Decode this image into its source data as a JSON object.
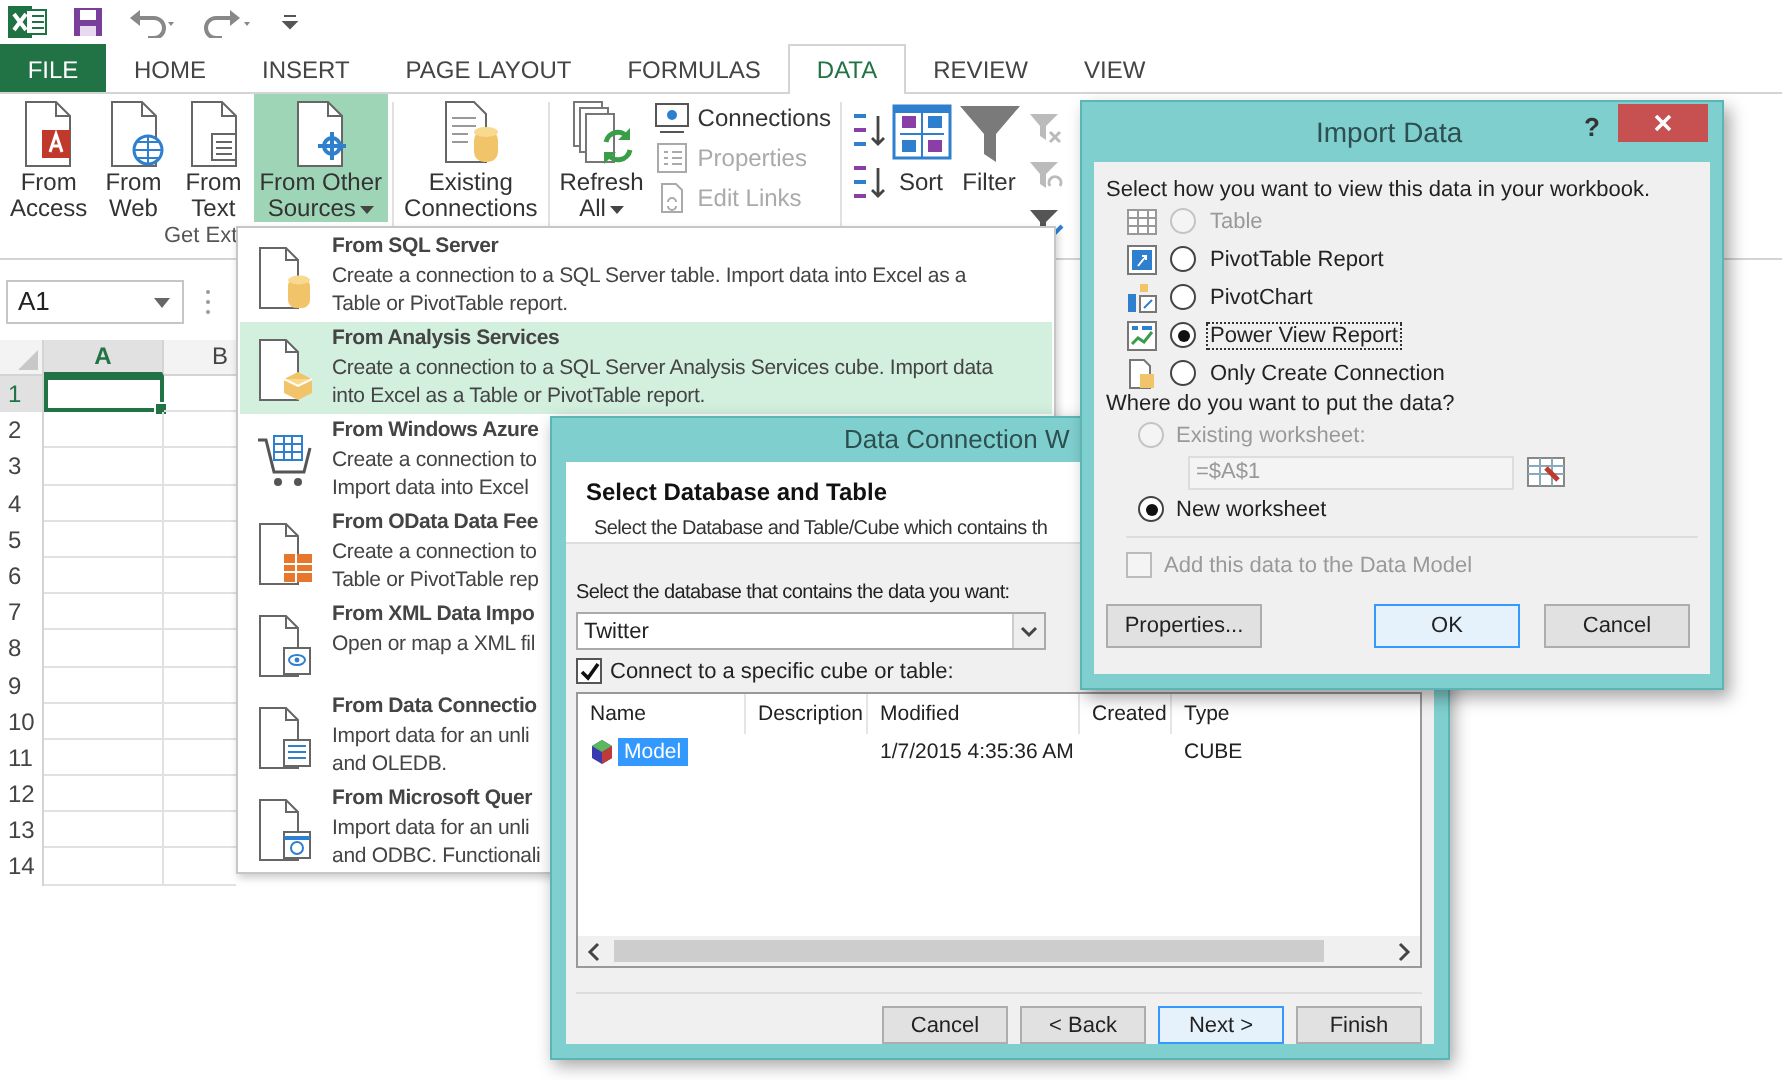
{
  "ribbon": {
    "tabs": [
      {
        "label": "FILE",
        "kind": "file",
        "selected": false
      },
      {
        "label": "HOME",
        "kind": "tab",
        "selected": false
      },
      {
        "label": "INSERT",
        "kind": "tab",
        "selected": false
      },
      {
        "label": "PAGE LAYOUT",
        "kind": "tab",
        "selected": false
      },
      {
        "label": "FORMULAS",
        "kind": "tab",
        "selected": false
      },
      {
        "label": "DATA",
        "kind": "tab",
        "selected": true
      },
      {
        "label": "REVIEW",
        "kind": "tab",
        "selected": false
      },
      {
        "label": "VIEW",
        "kind": "tab",
        "selected": false
      }
    ],
    "external_buttons": [
      {
        "lines": [
          "From",
          "Access"
        ],
        "kind": "access",
        "selected": false,
        "dropdown": false
      },
      {
        "lines": [
          "From",
          "Web"
        ],
        "kind": "web",
        "selected": false,
        "dropdown": false
      },
      {
        "lines": [
          "From",
          "Text"
        ],
        "kind": "text",
        "selected": false,
        "dropdown": false
      },
      {
        "lines": [
          "From Other",
          "Sources"
        ],
        "kind": "other",
        "selected": true,
        "dropdown": true
      }
    ],
    "existing": {
      "lines": [
        "Existing",
        "Connections"
      ]
    },
    "group_label": "Get Ext",
    "refresh": {
      "lines": [
        "Refresh",
        "All"
      ],
      "dropdown": true
    },
    "connection_items": [
      {
        "label": "Connections",
        "kind": "connections",
        "disabled": false
      },
      {
        "label": "Properties",
        "kind": "properties",
        "disabled": true
      },
      {
        "label": "Edit Links",
        "kind": "links",
        "disabled": true
      }
    ],
    "sort": {
      "label": "Sort"
    },
    "filter": {
      "label": "Filter"
    }
  },
  "name_box": {
    "value": "A1"
  },
  "sheet": {
    "columns": [
      {
        "label": "A",
        "selected": true
      },
      {
        "label": "B",
        "selected": false
      }
    ],
    "rows": [
      {
        "label": "1",
        "selected": true
      },
      {
        "label": "2",
        "selected": false
      },
      {
        "label": "3",
        "selected": false
      },
      {
        "label": "4",
        "selected": false
      },
      {
        "label": "5",
        "selected": false
      },
      {
        "label": "6",
        "selected": false
      },
      {
        "label": "7",
        "selected": false
      },
      {
        "label": "8",
        "selected": false
      },
      {
        "label": "9",
        "selected": false
      },
      {
        "label": "10",
        "selected": false
      },
      {
        "label": "11",
        "selected": false
      },
      {
        "label": "12",
        "selected": false
      },
      {
        "label": "13",
        "selected": false
      },
      {
        "label": "14",
        "selected": false
      }
    ]
  },
  "source_menu": [
    {
      "title": "From SQL Server",
      "description": [
        "Create a connection to a SQL Server table. Import data into Excel as a",
        "Table or PivotTable report."
      ],
      "kind": "sql",
      "selected": false
    },
    {
      "title": "From Analysis Services",
      "description": [
        "Create a connection to a SQL Server Analysis Services cube. Import data",
        "into Excel as a Table or PivotTable report."
      ],
      "kind": "cube",
      "selected": true
    },
    {
      "title": "From Windows Azure",
      "description": [
        "Create a connection to",
        "Import data into Excel"
      ],
      "kind": "cart",
      "selected": false
    },
    {
      "title": "From OData Data Fee",
      "description": [
        "Create a connection to",
        "Table or PivotTable rep"
      ],
      "kind": "odata",
      "selected": false
    },
    {
      "title": "From XML Data Impo",
      "description": [
        "Open or map a XML fil"
      ],
      "kind": "xml",
      "selected": false
    },
    {
      "title": "From Data Connectio",
      "description": [
        "Import data for an unli",
        "and OLEDB."
      ],
      "kind": "connection",
      "selected": false
    },
    {
      "title": "From Microsoft Quer",
      "description": [
        "Import data for an unli",
        "and ODBC. Functionali"
      ],
      "kind": "query",
      "selected": false
    }
  ],
  "wizard": {
    "title": "Data Connection W",
    "heading": "Select Database and Table",
    "subtitle": "Select the Database and Table/Cube which contains th",
    "database_label": "Select the database that contains the data you want:",
    "database_value": "Twitter",
    "connect_checkbox": {
      "label": "Connect to a specific cube or table:",
      "checked": true
    },
    "columns": [
      "Name",
      "Description",
      "Modified",
      "Created",
      "Type"
    ],
    "rows": [
      {
        "name": "Model",
        "modified": "1/7/2015 4:35:36 AM",
        "type": "CUBE",
        "selected": true
      }
    ],
    "buttons": [
      {
        "label": "Cancel",
        "default": false
      },
      {
        "label": "< Back",
        "default": false
      },
      {
        "label": "Next >",
        "default": true
      },
      {
        "label": "Finish",
        "default": false
      }
    ]
  },
  "import_dialog": {
    "title": "Import Data",
    "help": "?",
    "view_prompt": "Select how you want to view this data in your workbook.",
    "view_options": [
      {
        "label": "Table",
        "kind": "table",
        "selected": false,
        "disabled": true
      },
      {
        "label": "PivotTable Report",
        "kind": "pivottable",
        "selected": false,
        "disabled": false
      },
      {
        "label": "PivotChart",
        "kind": "pivotchart",
        "selected": false,
        "disabled": false
      },
      {
        "label": "Power View Report",
        "kind": "powerview",
        "selected": true,
        "disabled": false
      },
      {
        "label": "Only Create Connection",
        "kind": "connection",
        "selected": false,
        "disabled": false
      }
    ],
    "location_prompt": "Where do you want to put the data?",
    "existing": {
      "label": "Existing worksheet:",
      "selected": false,
      "disabled": true,
      "reference": "=$A$1"
    },
    "new": {
      "label": "New worksheet",
      "selected": true,
      "disabled": false
    },
    "data_model": {
      "label": "Add this data to the Data Model",
      "checked": false,
      "disabled": true
    },
    "buttons": [
      {
        "label": "Properties...",
        "default": false
      },
      {
        "label": "OK",
        "default": true
      },
      {
        "label": "Cancel",
        "default": false
      }
    ]
  }
}
